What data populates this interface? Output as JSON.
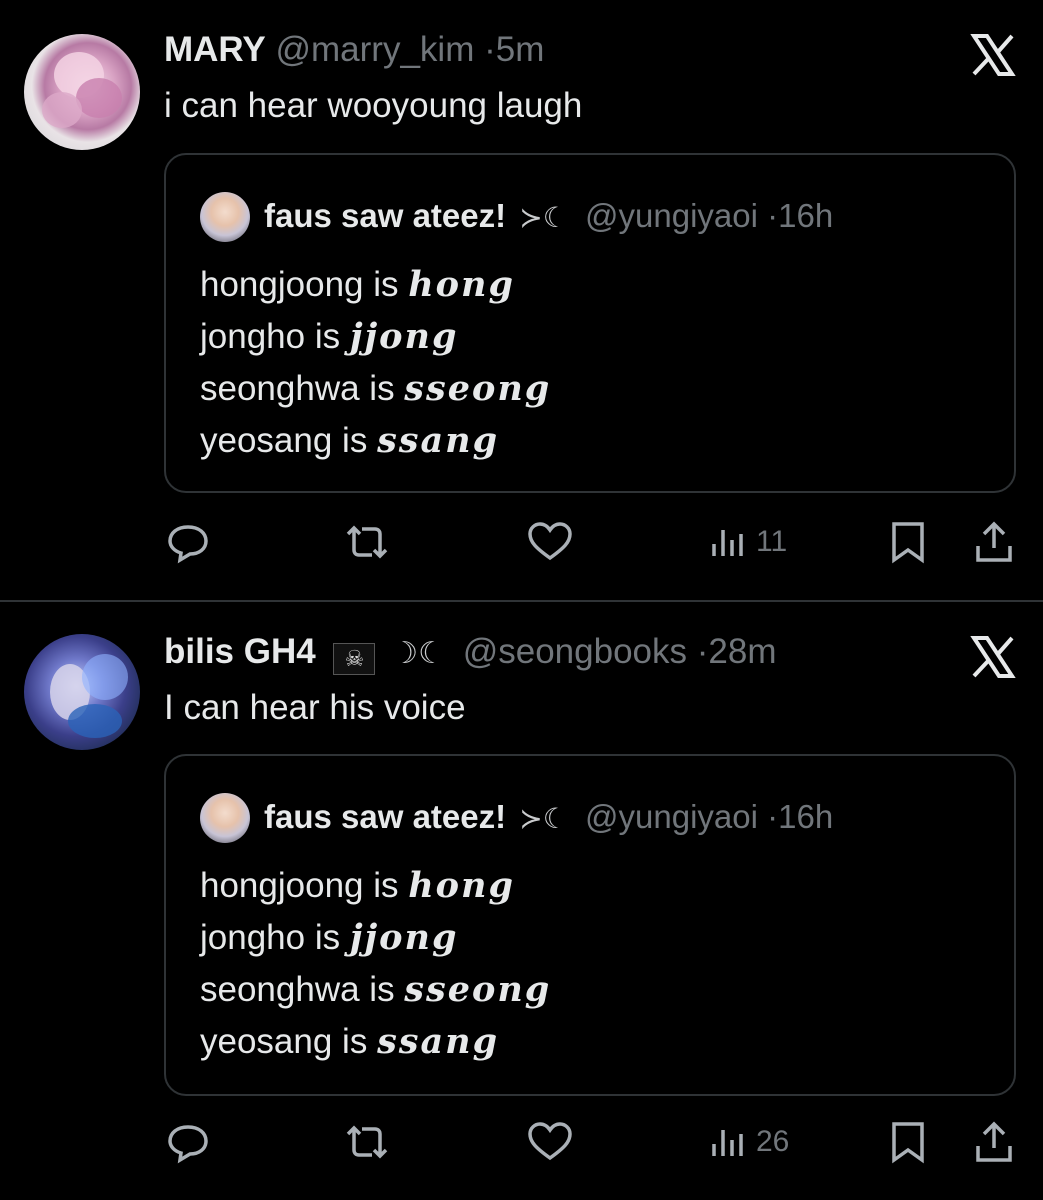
{
  "tweets": [
    {
      "author_name": "MARY",
      "handle": "@marry_kim",
      "separator": "·",
      "time": "5m",
      "text": "i can hear wooyoung laugh",
      "quote": {
        "author_name": "faus saw ateez!",
        "moon_glyph": "≻☾",
        "handle": "@yungiyaoi",
        "separator": "·",
        "time": "16h",
        "lines": [
          {
            "plain": "hongjoong is ",
            "fancy": "hong"
          },
          {
            "plain": "jongho is ",
            "fancy": "jjong"
          },
          {
            "plain": "seonghwa is ",
            "fancy": "sseong"
          },
          {
            "plain": "yeosang is ",
            "fancy": "ssang"
          }
        ]
      },
      "views": "11",
      "avatar_icon": "magnolia-avatar"
    },
    {
      "author_name": "bilis GH4",
      "flag_glyph": "☠",
      "moons": "☽☾",
      "handle": "@seongbooks",
      "separator": "·",
      "time": "28m",
      "text": "I can hear his voice",
      "quote": {
        "author_name": "faus saw ateez!",
        "moon_glyph": "≻☾",
        "handle": "@yungiyaoi",
        "separator": "·",
        "time": "16h",
        "lines": [
          {
            "plain": "hongjoong is ",
            "fancy": "hong"
          },
          {
            "plain": "jongho is ",
            "fancy": "jjong"
          },
          {
            "plain": "seonghwa is ",
            "fancy": "sseong"
          },
          {
            "plain": "yeosang is ",
            "fancy": "ssang"
          }
        ]
      },
      "views": "26",
      "avatar_icon": "anime-character-avatar"
    }
  ],
  "colors": {
    "background": "#000000",
    "text": "#e7e9ea",
    "muted": "#71767b",
    "border": "#2f3336"
  }
}
